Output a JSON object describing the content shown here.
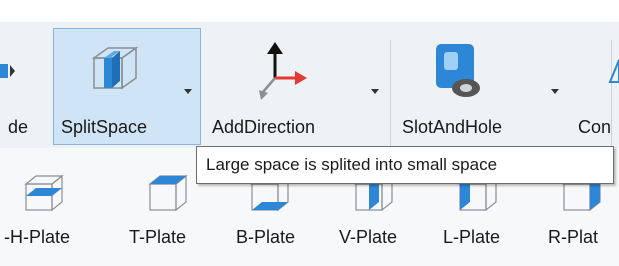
{
  "ribbon": {
    "buttons": [
      {
        "label": "de"
      },
      {
        "label": "SplitSpace"
      },
      {
        "label": "AddDirection"
      },
      {
        "label": "SlotAndHole"
      },
      {
        "label": "Con"
      }
    ]
  },
  "tooltip": {
    "text": "Large space is splited into small space"
  },
  "plates": [
    {
      "label": "-H-Plate"
    },
    {
      "label": "T-Plate"
    },
    {
      "label": "B-Plate"
    },
    {
      "label": "V-Plate"
    },
    {
      "label": "L-Plate"
    },
    {
      "label": "R-Plat"
    }
  ],
  "icons": {
    "prev": "partial-arrow-icon",
    "splitspace": "split-space-cube-icon",
    "adddirection": "axis-direction-arrows-icon",
    "slotandhole": "slot-and-hole-icon",
    "con": "partial-shape-icon",
    "plates": [
      "h-plate-icon",
      "t-plate-icon",
      "b-plate-icon",
      "v-plate-icon",
      "l-plate-icon",
      "r-plate-icon"
    ]
  },
  "colors": {
    "ribbon_bg": "#eef2f4",
    "selected_bg": "#cfe4f5",
    "selected_border": "#8ab4d9",
    "accent_blue": "#2e86d6",
    "arrow_red": "#e53935"
  }
}
